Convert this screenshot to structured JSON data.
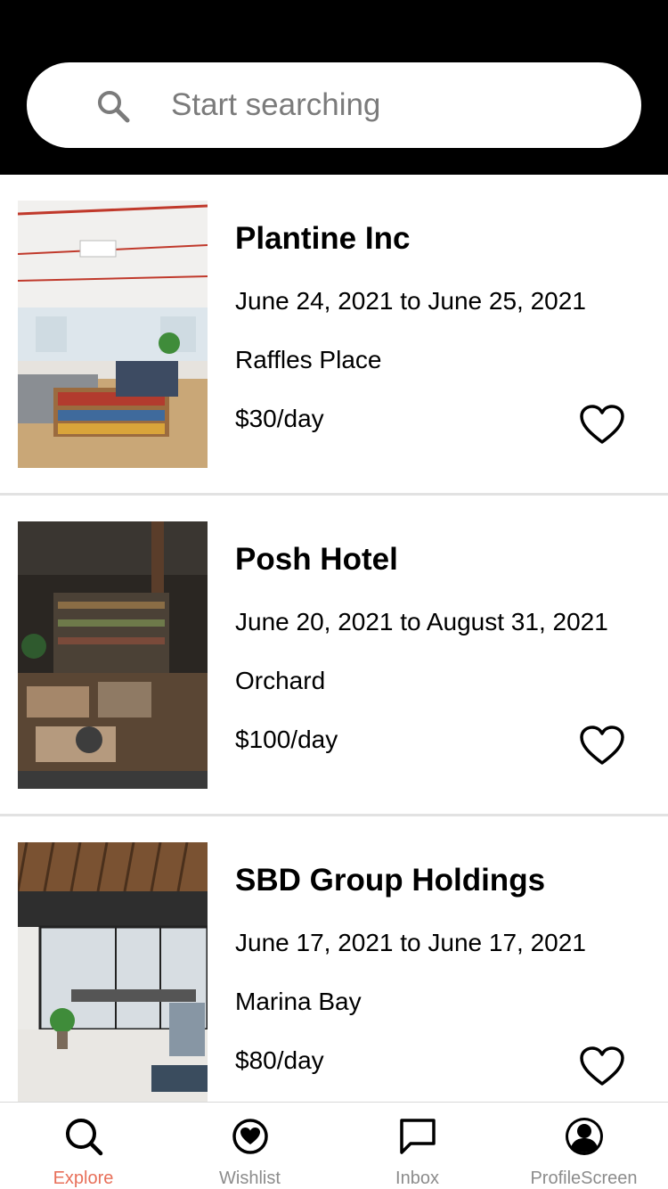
{
  "search": {
    "placeholder": "Start searching"
  },
  "listings": [
    {
      "title": "Plantine Inc",
      "dates": "June 24, 2021 to June 25, 2021",
      "location": "Raffles Place",
      "price": "$30/day",
      "favorited": false
    },
    {
      "title": "Posh Hotel",
      "dates": "June 20, 2021 to August 31, 2021",
      "location": "Orchard",
      "price": "$100/day",
      "favorited": false
    },
    {
      "title": "SBD Group Holdings",
      "dates": "June 17, 2021 to June 17, 2021",
      "location": "Marina Bay",
      "price": "$80/day",
      "favorited": false
    }
  ],
  "tabs": [
    {
      "label": "Explore",
      "icon": "search-icon",
      "active": true
    },
    {
      "label": "Wishlist",
      "icon": "heart-circle-icon",
      "active": false
    },
    {
      "label": "Inbox",
      "icon": "chat-bubble-icon",
      "active": false
    },
    {
      "label": "ProfileScreen",
      "icon": "user-circle-icon",
      "active": false
    }
  ],
  "colors": {
    "header_bg": "#000000",
    "active_tab": "#e8705a",
    "inactive_tab": "#8c8c8c",
    "divider": "#e2e2e2"
  }
}
